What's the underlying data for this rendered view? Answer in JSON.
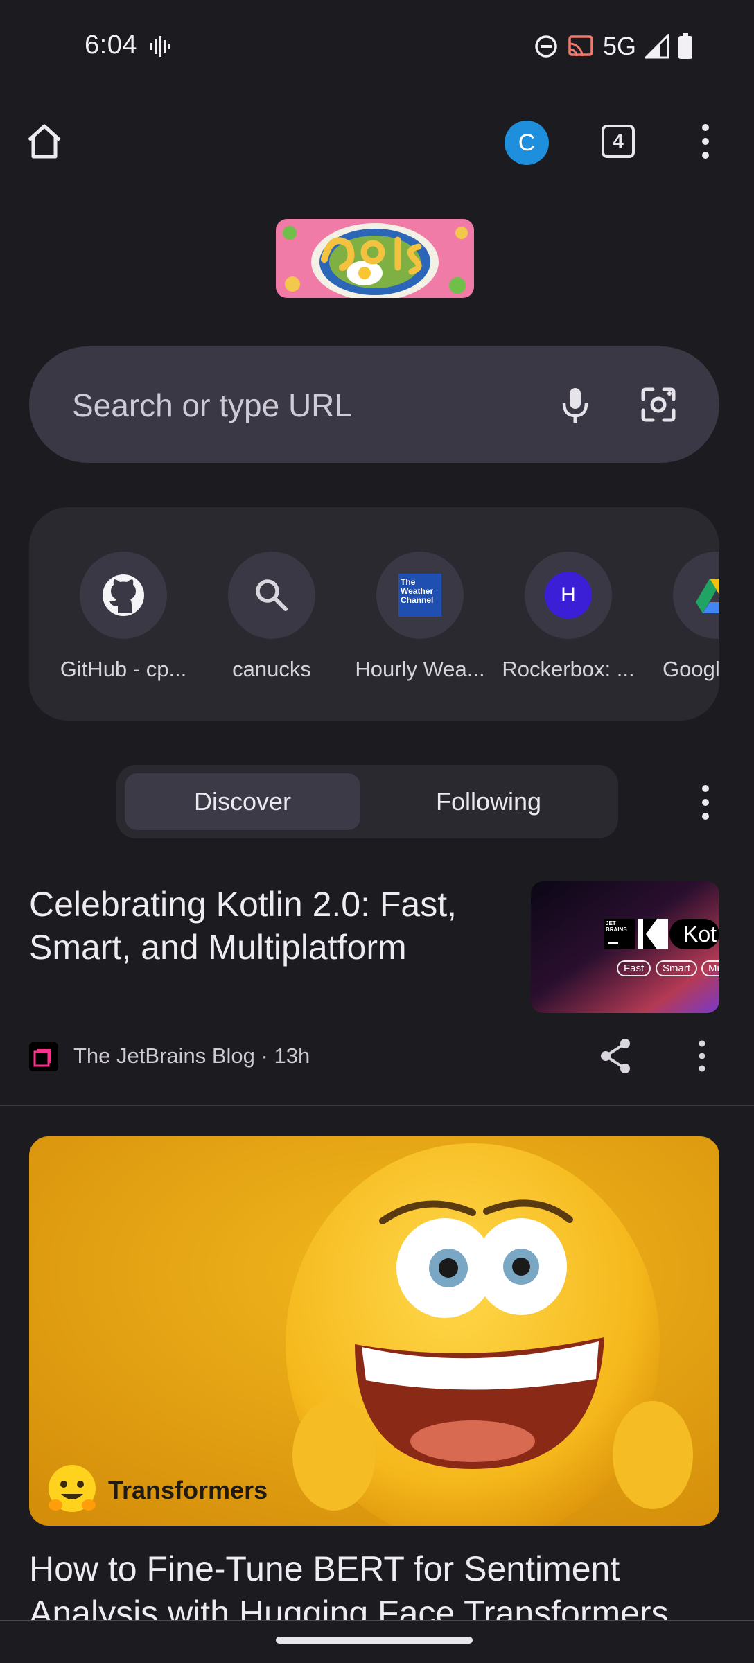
{
  "status_bar": {
    "time": "6:04",
    "network": "5G"
  },
  "toolbar": {
    "avatar_letter": "C",
    "tab_count": "4"
  },
  "search": {
    "placeholder": "Search or type URL"
  },
  "shortcuts": [
    {
      "label": "GitHub - cp...",
      "icon": "github-icon"
    },
    {
      "label": "canucks",
      "icon": "search-icon"
    },
    {
      "label": "Hourly Wea...",
      "icon": "weather-channel-icon",
      "icon_text": "The Weather Channel"
    },
    {
      "label": "Rockerbox: ...",
      "icon": "letter-icon",
      "icon_text": "H"
    },
    {
      "label": "Google",
      "icon": "google-drive-icon"
    }
  ],
  "feed": {
    "tabs": [
      "Discover",
      "Following"
    ],
    "active_tab": "Discover"
  },
  "articles": [
    {
      "title": "Celebrating Kotlin 2.0: Fast, Smart, and Multiplatform",
      "source": "The JetBrains Blog · 13h",
      "thumb_text": {
        "brand": "JET BRAINS",
        "name": "Kot",
        "tags": [
          "Fast",
          "Smart",
          "Mu"
        ]
      }
    },
    {
      "title": "How to Fine-Tune BERT for Sentiment Analysis with Hugging Face Transformers",
      "image_caption": "Transformers"
    }
  ],
  "colors": {
    "background": "#1c1b20",
    "search_box": "#3a3844",
    "surface": "#2a2930",
    "avatar": "#1e8fdc",
    "rockerbox": "#3a1fd6"
  }
}
